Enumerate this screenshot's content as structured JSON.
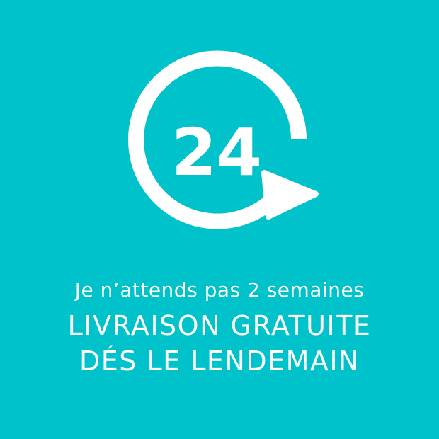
{
  "colors": {
    "background": "#00c2cb",
    "foreground": "#ffffff"
  },
  "icon": {
    "name": "clock-arrow-icon",
    "number": "24"
  },
  "text": {
    "tagline": "Je n’attends pas 2 semaines",
    "headline_line1": "LIVRAISON GRATUITE",
    "headline_line2": "DÉS LE LENDEMAIN"
  }
}
